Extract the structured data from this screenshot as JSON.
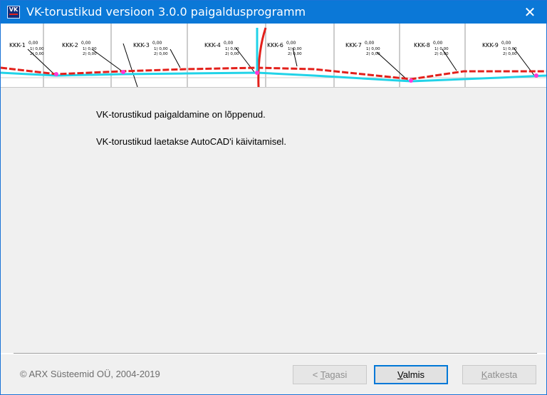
{
  "window": {
    "title": "VK-torustikud versioon 3.0.0 paigaldusprogramm",
    "icon_name": "vk-app-icon",
    "close_glyph": "✕"
  },
  "banner": {
    "labels": [
      "KKK-1",
      "KKK-2",
      "KKK-3",
      "KKK-4",
      "KKK-6",
      "KKK-7",
      "KKK-8",
      "KKK-9"
    ],
    "small_text": "0,00",
    "sub_lines": [
      "1) 0,00",
      "2) 0,00"
    ],
    "colors": {
      "pipe_red": "#e3201b",
      "pipe_cyan": "#21d3e8",
      "node": "#ff38d8"
    }
  },
  "main": {
    "messages": [
      "VK-torustikud paigaldamine on lõppenud.",
      "VK-torustikud laetakse AutoCAD'i käivitamisel."
    ]
  },
  "footer": {
    "copyright": "© ARX Süsteemid OÜ, 2004-2019",
    "back": {
      "prefix": "< ",
      "accel": "T",
      "rest": "agasi",
      "enabled": false
    },
    "finish": {
      "accel": "V",
      "rest": "almis",
      "enabled": true
    },
    "cancel": {
      "accel": "K",
      "rest": "atkesta",
      "enabled": false
    }
  }
}
